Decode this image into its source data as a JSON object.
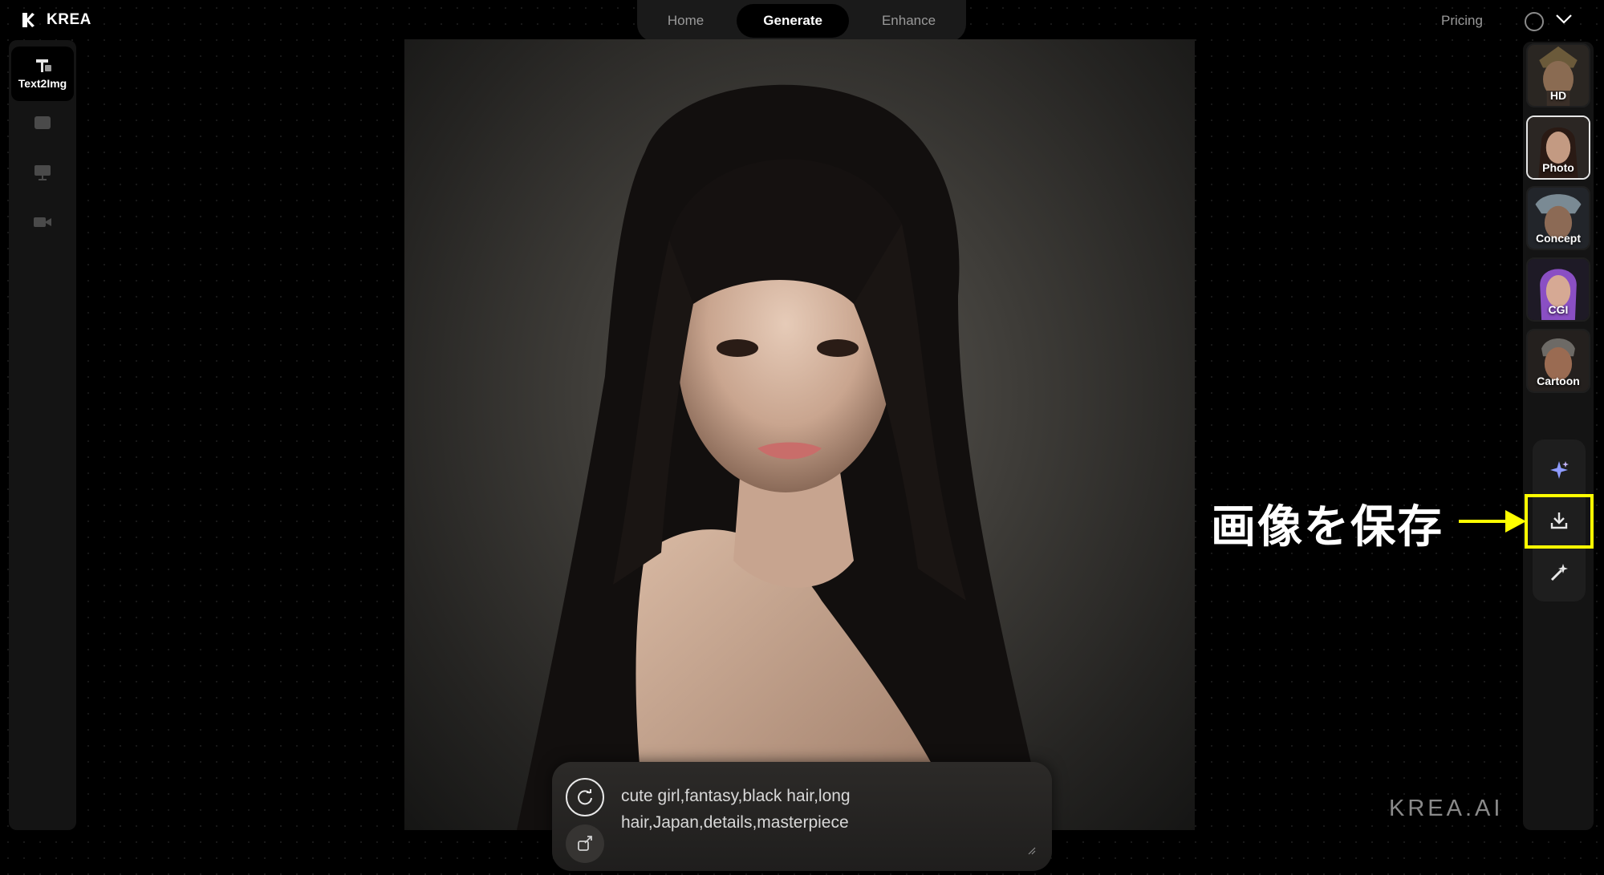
{
  "app": {
    "name": "KREA",
    "watermark": "KREA.AI"
  },
  "nav": {
    "tabs": [
      {
        "label": "Home"
      },
      {
        "label": "Generate"
      },
      {
        "label": "Enhance"
      }
    ],
    "active": "Generate"
  },
  "header": {
    "pricing_label": "Pricing"
  },
  "tools": [
    {
      "label": "Text2Img",
      "icon": "text2img-icon",
      "active": true
    },
    {
      "icon": "image-icon"
    },
    {
      "icon": "monitor-icon"
    },
    {
      "icon": "video-icon"
    }
  ],
  "prompt": {
    "text": "cute girl,fantasy,black hair,long hair,Japan,details,masterpiece"
  },
  "styles": [
    {
      "label": "HD"
    },
    {
      "label": "Photo",
      "selected": true
    },
    {
      "label": "Concept"
    },
    {
      "label": "CGI"
    },
    {
      "label": "Cartoon"
    }
  ],
  "actions": [
    {
      "icon": "sparkle-icon"
    },
    {
      "icon": "download-icon"
    },
    {
      "icon": "magic-wand-icon"
    }
  ],
  "annotation": {
    "text": "画像を保存",
    "color": "#ffff00"
  }
}
